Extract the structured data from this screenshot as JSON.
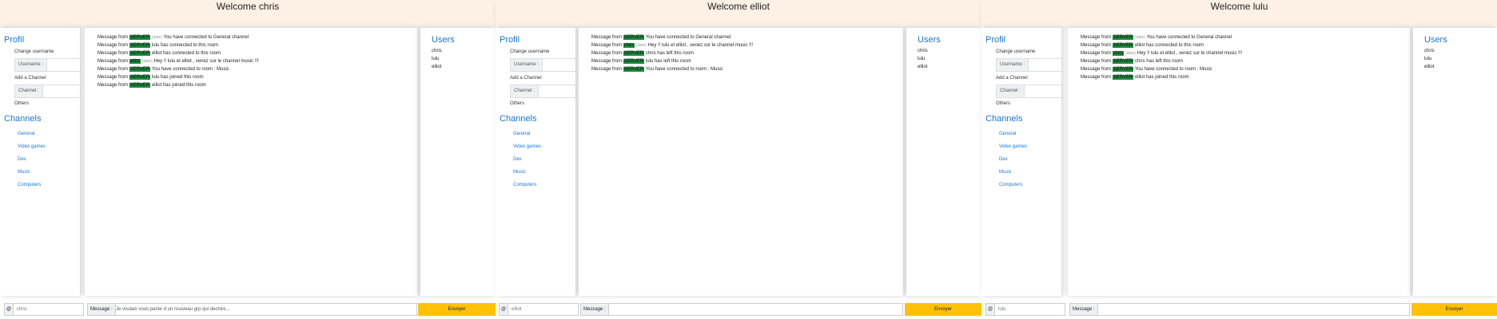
{
  "panes": [
    {
      "header": "Welcome chris",
      "profile": {
        "title": "Profil",
        "change_username": "Change username",
        "username_prefix": "Username :",
        "add_channel": "Add a Channel",
        "channel_prefix": "Channel :",
        "others": "Others"
      },
      "channels": {
        "title": "Channels",
        "items": [
          "General",
          "Video games",
          "Dev",
          "Music",
          "Computers"
        ]
      },
      "messages": [
        {
          "prefix": "Message from",
          "sender": "SERVER",
          "date": "(date)",
          "text": "You have connected to General channel"
        },
        {
          "prefix": "Message from",
          "sender": "SERVER",
          "date": "",
          "text": "lulu has connected to this room"
        },
        {
          "prefix": "Message from",
          "sender": "SERVER",
          "date": "",
          "text": "elliot has connected to this room"
        },
        {
          "prefix": "Message from",
          "sender": "elliot",
          "date": "(date)",
          "text": "Hey !! lulu et elliot , venez sur le channel music !!!"
        },
        {
          "prefix": "Message from",
          "sender": "SERVER",
          "date": "",
          "text": "You have connected to room : Music"
        },
        {
          "prefix": "Message from",
          "sender": "SERVER",
          "date": "",
          "text": "lulu has joined this room"
        },
        {
          "prefix": "Message from",
          "sender": "SERVER",
          "date": "",
          "text": "elliot has joined this room"
        }
      ],
      "users": {
        "title": "Users",
        "items": [
          "chris",
          "lulu",
          "elliot"
        ]
      },
      "footer": {
        "at": "@",
        "username": "chris",
        "message_label": "Message :",
        "message_value": "Je voulais vous parler d un nouveau grp qui dechire...",
        "send": "Envoyer"
      }
    },
    {
      "header": "Welcome elliot",
      "profile": {
        "title": "Profil",
        "change_username": "Change username",
        "username_prefix": "Username :",
        "add_channel": "Add a Channel",
        "channel_prefix": "Channel :",
        "others": "Others"
      },
      "channels": {
        "title": "Channels",
        "items": [
          "General",
          "Video games",
          "Dev",
          "Music",
          "Computers"
        ]
      },
      "messages": [
        {
          "prefix": "Message from",
          "sender": "SERVER",
          "date": "",
          "text": "You have connected to General channel"
        },
        {
          "prefix": "Message from",
          "sender": "chris",
          "date": "(date)",
          "text": "Hey !! lulu et elliot , venez sur le channel music !!!"
        },
        {
          "prefix": "Message from",
          "sender": "SERVER",
          "date": "",
          "text": "chris has left this room"
        },
        {
          "prefix": "Message from",
          "sender": "SERVER",
          "date": "",
          "text": "lulu has left this room"
        },
        {
          "prefix": "Message from",
          "sender": "SERVER",
          "date": "",
          "text": "You have connected to room : Music"
        }
      ],
      "users": {
        "title": "Users",
        "items": [
          "chris",
          "lulu",
          "elliot"
        ]
      },
      "footer": {
        "at": "@",
        "username": "elliot",
        "message_label": "Message :",
        "message_value": "",
        "send": "Envoyer"
      }
    },
    {
      "header": "Welcome lulu",
      "profile": {
        "title": "Profil",
        "change_username": "Change username",
        "username_prefix": "Username :",
        "add_channel": "Add a Channel",
        "channel_prefix": "Channel :",
        "others": "Others"
      },
      "channels": {
        "title": "Channels",
        "items": [
          "General",
          "Video games",
          "Dev",
          "Music",
          "Computers"
        ]
      },
      "messages": [
        {
          "prefix": "Message from",
          "sender": "SERVER",
          "date": "(date)",
          "text": "You have connected to General channel"
        },
        {
          "prefix": "Message from",
          "sender": "SERVER",
          "date": "",
          "text": "elliot has connected to this room"
        },
        {
          "prefix": "Message from",
          "sender": "chris",
          "date": "(date)",
          "text": "Hey !! lulu et elliot , venez sur le channel music !!!"
        },
        {
          "prefix": "Message from",
          "sender": "SERVER",
          "date": "",
          "text": "chris has left this room"
        },
        {
          "prefix": "Message from",
          "sender": "SERVER",
          "date": "",
          "text": "You have connected to room : Music"
        },
        {
          "prefix": "Message from",
          "sender": "SERVER",
          "date": "",
          "text": "elliot has joined this room"
        }
      ],
      "users": {
        "title": "Users",
        "items": [
          "chris",
          "lulu",
          "elliot"
        ]
      },
      "footer": {
        "at": "@",
        "username": "lulu",
        "message_label": "Message :",
        "message_value": "",
        "send": "Envoyer"
      }
    }
  ]
}
